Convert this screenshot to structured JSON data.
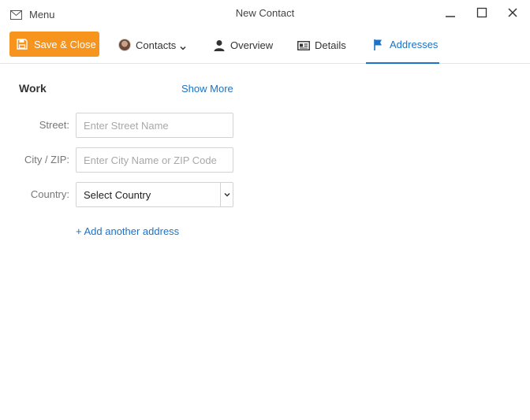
{
  "titlebar": {
    "menu_label": "Menu",
    "window_title": "New Contact"
  },
  "toolbar": {
    "save_label": "Save & Close",
    "contacts_label": "Contacts",
    "tabs": [
      {
        "label": "Overview",
        "active": false
      },
      {
        "label": "Details",
        "active": false
      },
      {
        "label": "Addresses",
        "active": true
      }
    ]
  },
  "address_section": {
    "title": "Work",
    "show_more": "Show More",
    "street": {
      "label": "Street:",
      "value": "",
      "placeholder": "Enter Street Name"
    },
    "city": {
      "label": "City / ZIP:",
      "value": "",
      "placeholder": "Enter City Name or ZIP Code"
    },
    "country": {
      "label": "Country:",
      "selected": "Select Country"
    },
    "add_another": "+ Add another address"
  },
  "colors": {
    "accent": "#1a73c9",
    "save_button": "#f7941d"
  },
  "icons": {
    "menu": "mail-icon",
    "save": "floppy-disk-icon",
    "overview": "person-icon",
    "details": "id-card-icon",
    "addresses": "flag-icon"
  }
}
